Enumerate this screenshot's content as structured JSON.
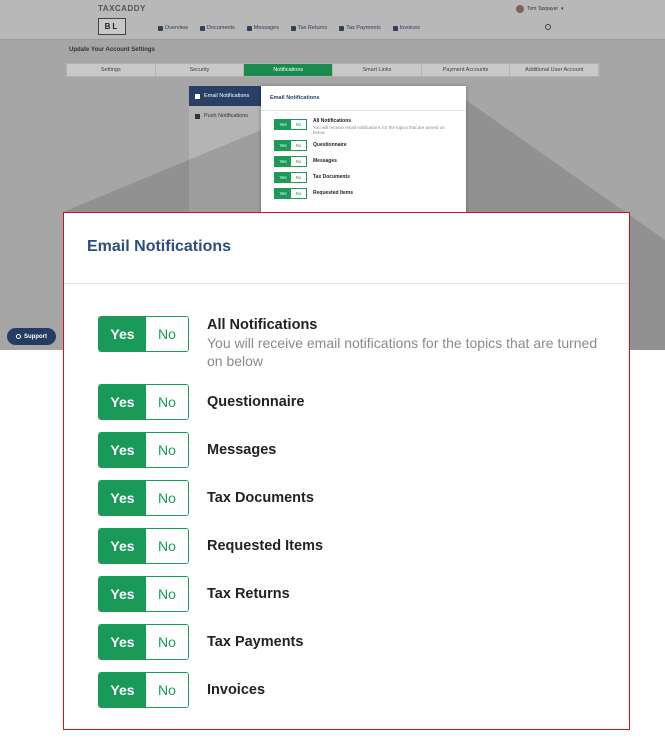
{
  "background": {
    "brand": "TAXCADDY",
    "logo_text": "BL",
    "user_name": "Tom Taxpayer",
    "nav": [
      "Overview",
      "Documents",
      "Messages",
      "Tax Returns",
      "Tax Payments",
      "Invoices"
    ],
    "page_title": "Update Your Account Settings",
    "tabs": [
      "Settings",
      "Security",
      "Notifications",
      "Smart Links",
      "Payment Accounts",
      "Additional User Account"
    ],
    "active_tab": "Notifications",
    "side_items": [
      "Email Notifications",
      "Push Notifications"
    ],
    "support_label": "Support"
  },
  "panel": {
    "title": "Email Notifications",
    "yes_label": "Yes",
    "no_label": "No",
    "items": [
      {
        "label": "All Notifications",
        "desc": "You will receive email notifications for the topics that are turned on below",
        "value": "Yes"
      },
      {
        "label": "Questionnaire",
        "value": "Yes"
      },
      {
        "label": "Messages",
        "value": "Yes"
      },
      {
        "label": "Tax Documents",
        "value": "Yes"
      },
      {
        "label": "Requested Items",
        "value": "Yes"
      },
      {
        "label": "Tax Returns",
        "value": "Yes"
      },
      {
        "label": "Tax Payments",
        "value": "Yes"
      },
      {
        "label": "Invoices",
        "value": "Yes"
      }
    ]
  },
  "colors": {
    "accent": "#1a9a58",
    "title": "#2c4e7c",
    "highlight_border": "#c9141b"
  }
}
